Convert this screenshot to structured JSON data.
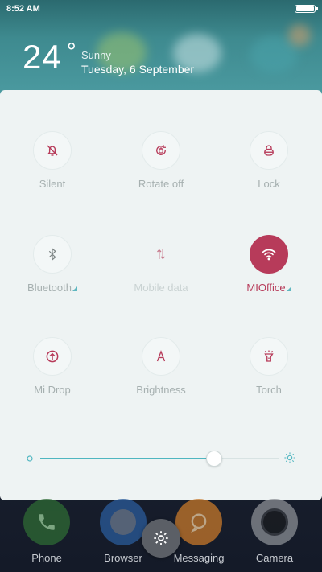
{
  "status_bar": {
    "time": "8:52 AM",
    "battery_level": 1.0
  },
  "weather": {
    "temperature": "24",
    "degree_symbol": "°",
    "condition": "Sunny",
    "date": "Tuesday, 6 September"
  },
  "toggles": [
    {
      "label": "Silent",
      "icon": "bell-off-icon",
      "state": "off"
    },
    {
      "label": "Rotate off",
      "icon": "rotate-lock-icon",
      "state": "off"
    },
    {
      "label": "Lock",
      "icon": "lock-icon",
      "state": "off"
    },
    {
      "label": "Bluetooth",
      "icon": "bluetooth-icon",
      "state": "off"
    },
    {
      "label": "Mobile data",
      "icon": "mobile-data-icon",
      "state": "disabled"
    },
    {
      "label": "MIOffice",
      "icon": "wifi-icon",
      "state": "on"
    },
    {
      "label": "Mi Drop",
      "icon": "mi-drop-icon",
      "state": "off"
    },
    {
      "label": "Brightness",
      "icon": "brightness-auto-icon",
      "state": "off"
    },
    {
      "label": "Torch",
      "icon": "torch-icon",
      "state": "off"
    }
  ],
  "brightness": {
    "level": 0.73
  },
  "dock": [
    {
      "label": "Phone",
      "icon": "phone-icon"
    },
    {
      "label": "Browser",
      "icon": "browser-icon"
    },
    {
      "label": "Messaging",
      "icon": "messaging-icon"
    },
    {
      "label": "Camera",
      "icon": "camera-icon"
    }
  ],
  "settings_icon": "gear-icon",
  "colors": {
    "accent": "#b73b5a",
    "teal": "#4fb6c0",
    "panel": "#eef3f3",
    "inactive_label": "#a6b0b0"
  }
}
